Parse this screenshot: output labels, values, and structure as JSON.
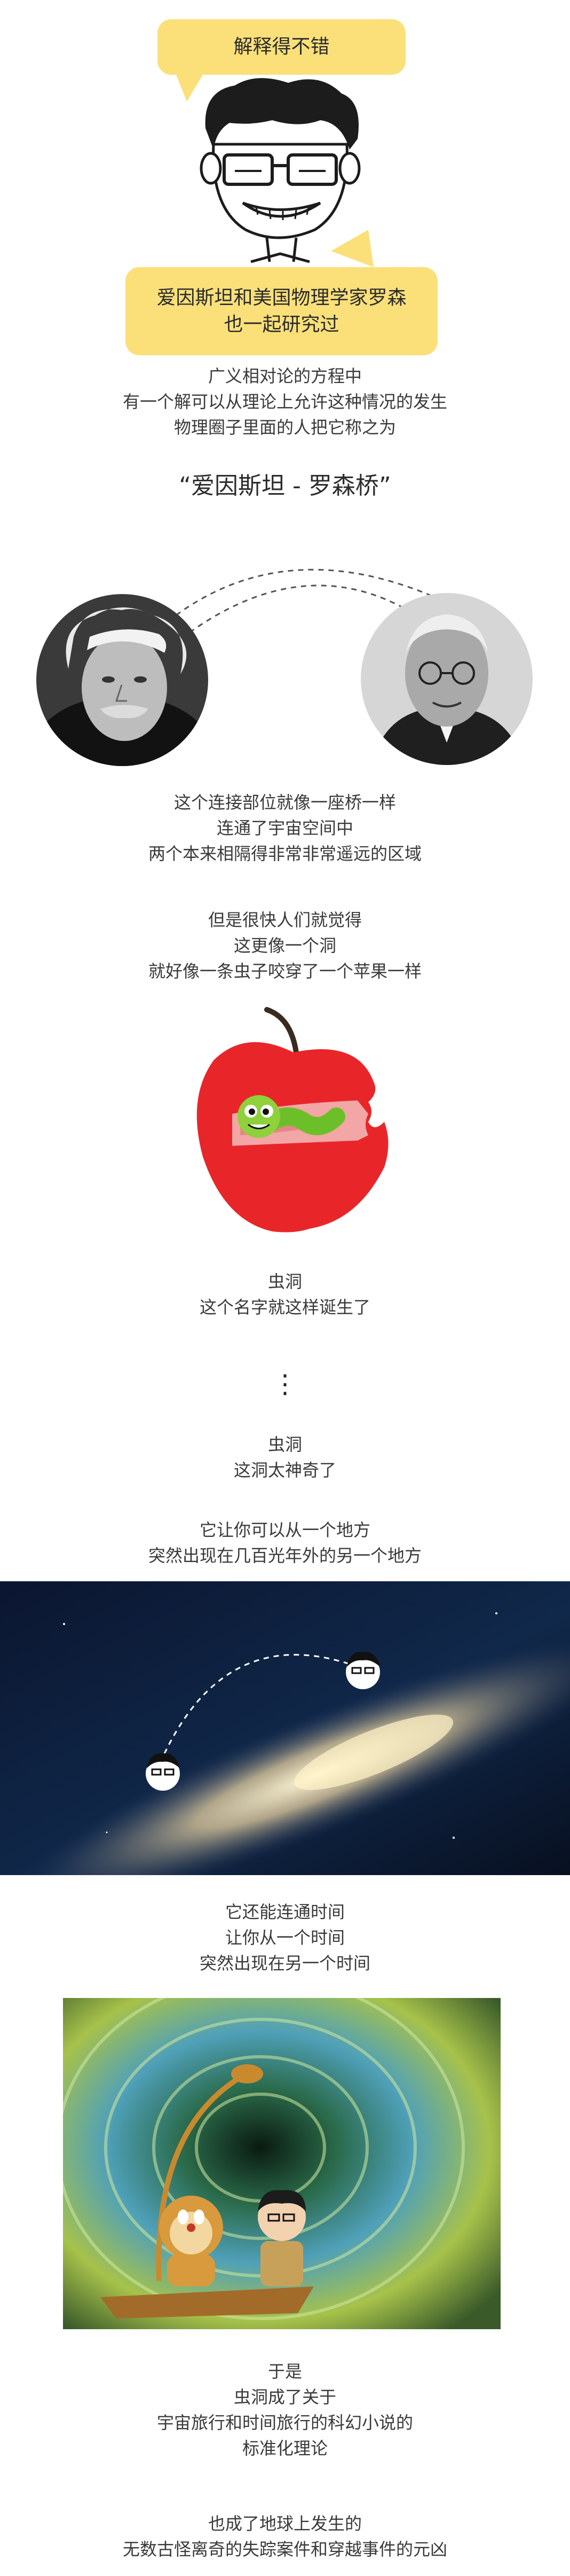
{
  "header": {
    "bubble_top": "解释得不错",
    "bubble_bottom_1": "爱因斯坦和美国物理学家罗森",
    "bubble_bottom_2": "也一起研究过"
  },
  "section1": {
    "lines": [
      "广义相对论的方程中",
      "有一个解可以从理论上允许这种情况的发生",
      "物理圈子里面的人把它称之为"
    ],
    "quote": "“爱因斯坦 - 罗森桥”"
  },
  "section2": {
    "lines": [
      "这个连接部位就像一座桥一样",
      "连通了宇宙空间中",
      "两个本来相隔得非常非常遥远的区域"
    ]
  },
  "section3": {
    "lines": [
      "但是很快人们就觉得",
      "这更像一个洞",
      "就好像一条虫子咬穿了一个苹果一样"
    ]
  },
  "section4": {
    "lines": [
      "虫洞",
      "这个名字就这样诞生了"
    ],
    "dots": "⋮"
  },
  "section5": {
    "lines": [
      "虫洞",
      "这洞太神奇了"
    ]
  },
  "section6": {
    "lines": [
      "它让你可以从一个地方",
      "突然出现在几百光年外的另一个地方"
    ]
  },
  "section7": {
    "lines": [
      "它还能连通时间",
      "让你从一个时间",
      "突然出现在另一个时间"
    ]
  },
  "section8": {
    "lines": [
      "于是",
      "虫洞成了关于",
      "宇宙旅行和时间旅行的科幻小说的",
      "标准化理论"
    ]
  },
  "section9": {
    "lines": [
      "也成了地球上发生的",
      "无数古怪离奇的失踪案件和穿越事件的元凶"
    ]
  },
  "colors": {
    "bubble": "#fbe07a",
    "apple": "#e8262a",
    "galaxy_bg": "#0b1630"
  }
}
